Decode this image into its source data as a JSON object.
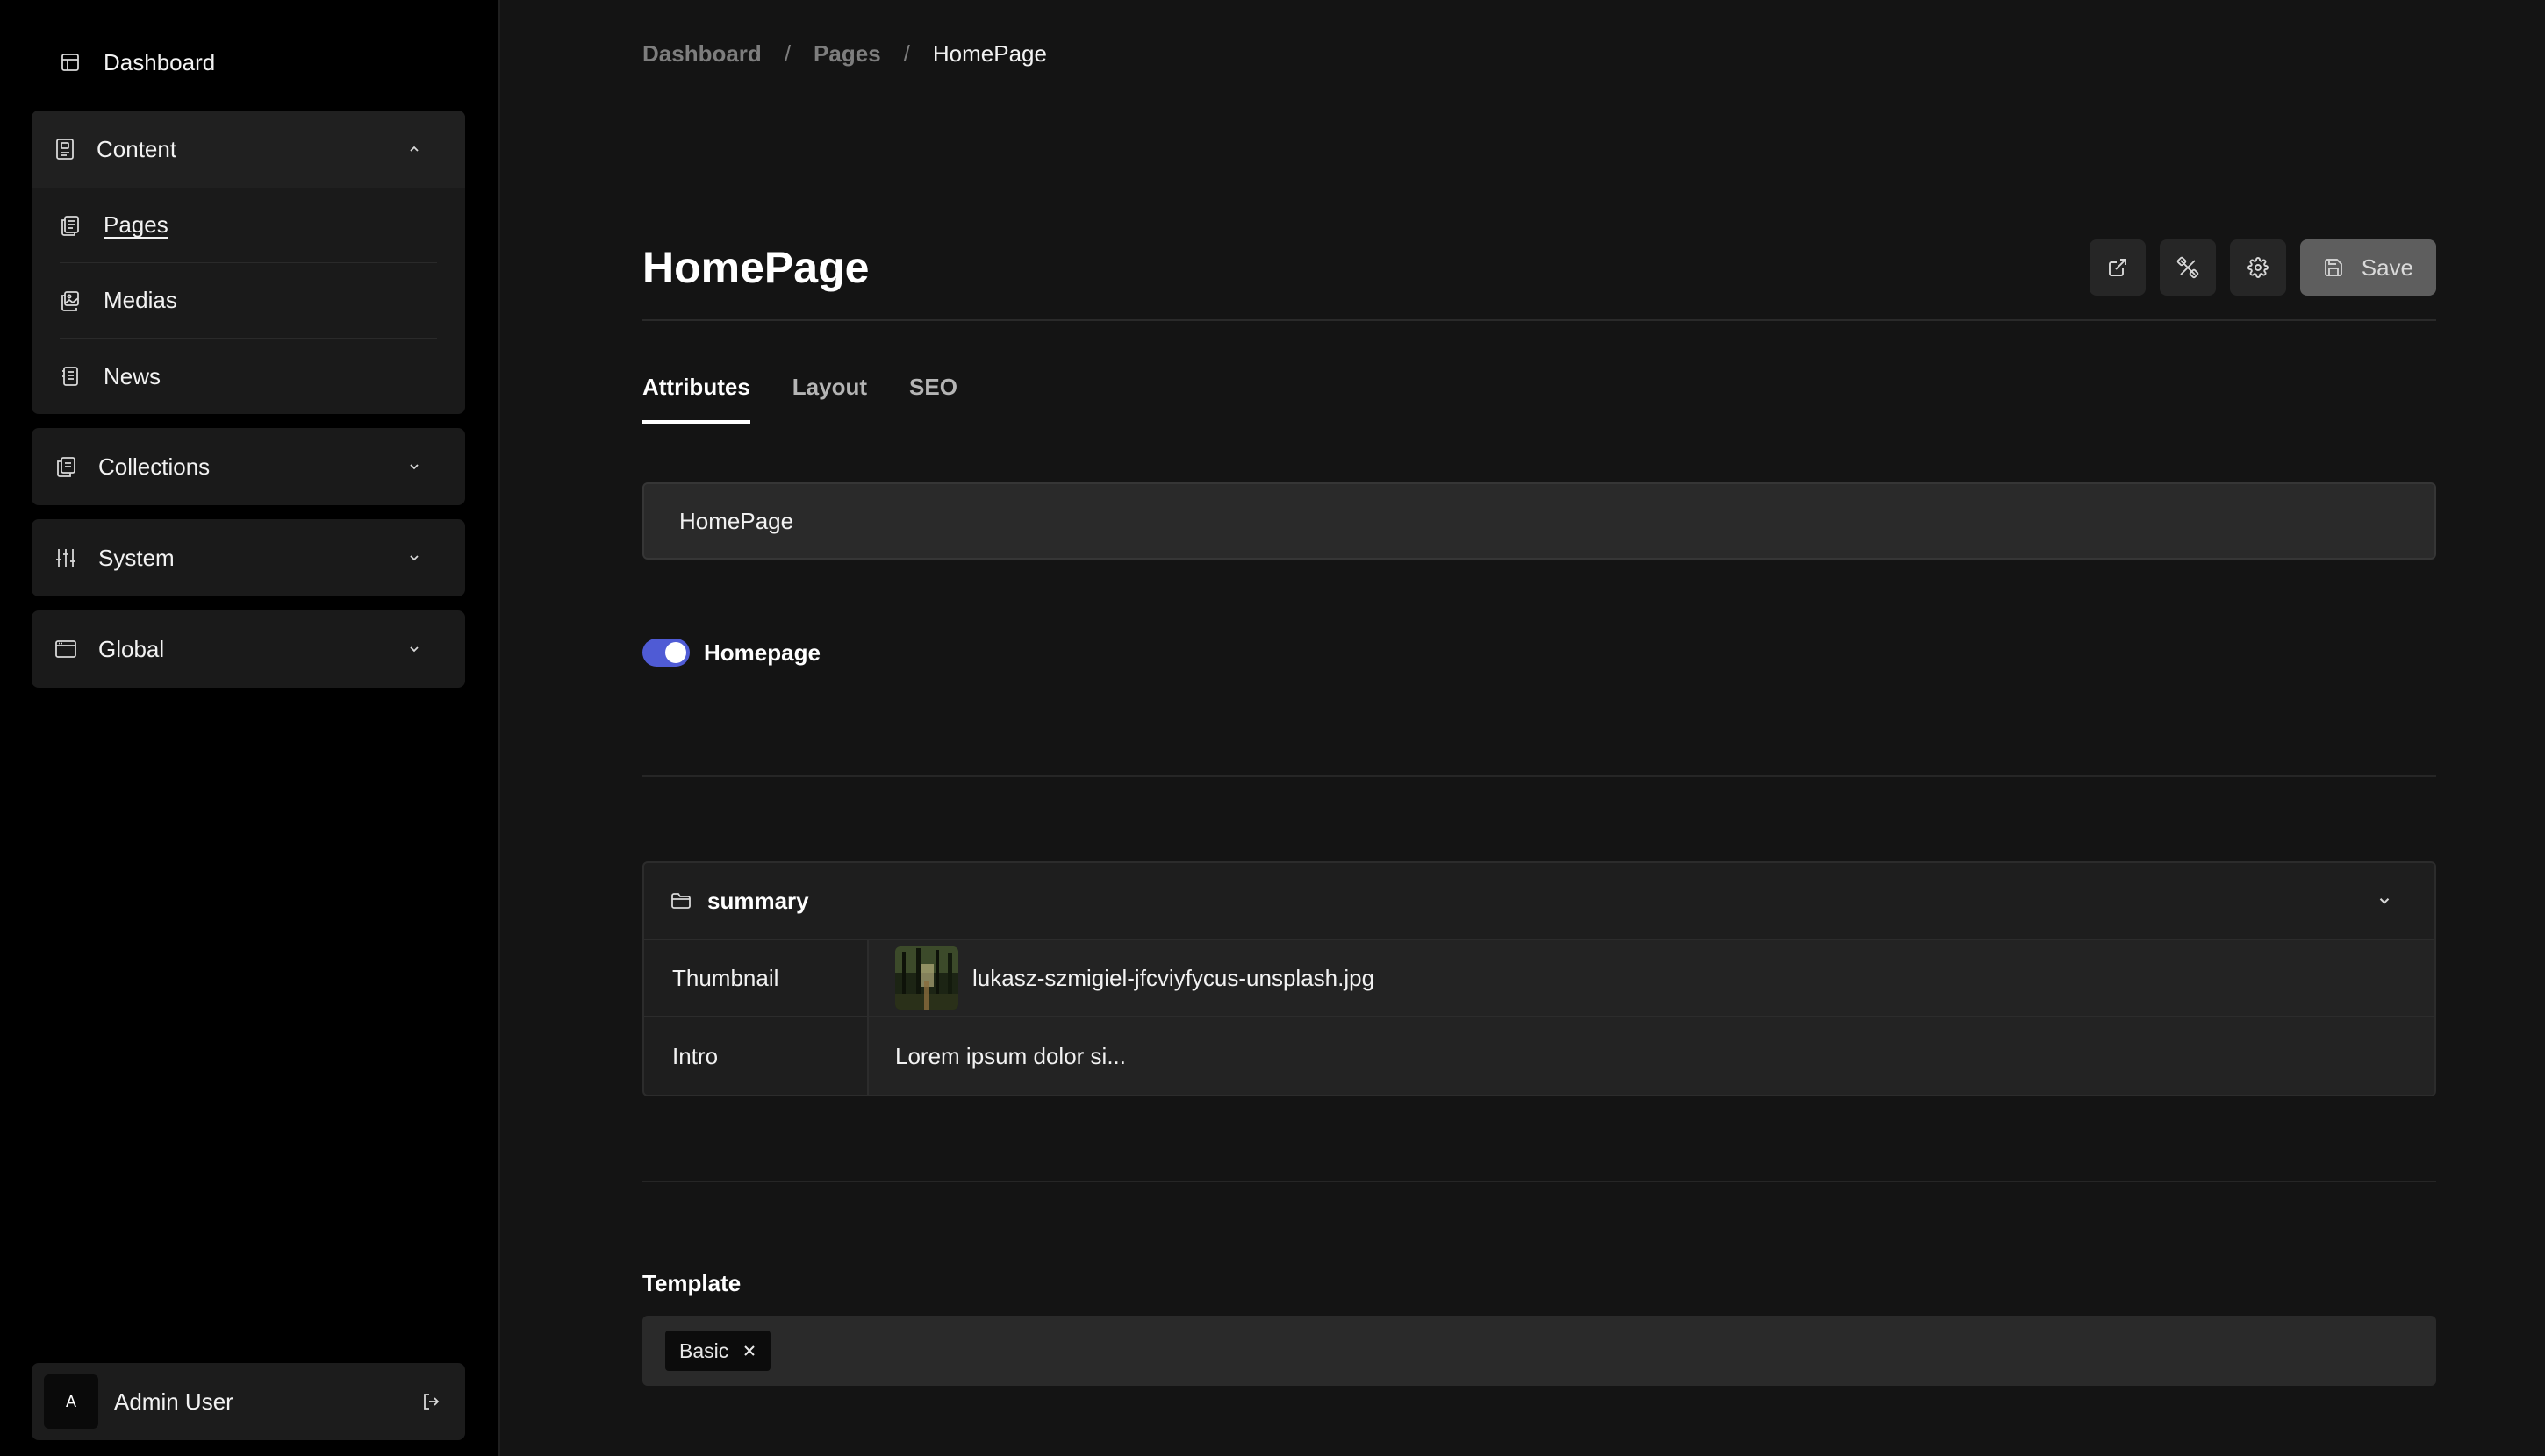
{
  "sidebar": {
    "dashboard": {
      "label": "Dashboard",
      "icon": "layout-dashboard-icon"
    },
    "groups": [
      {
        "label": "Content",
        "icon": "content-icon",
        "expanded": true,
        "items": [
          {
            "label": "Pages",
            "icon": "pages-icon",
            "active": true
          },
          {
            "label": "Medias",
            "icon": "image-icon",
            "active": false
          },
          {
            "label": "News",
            "icon": "news-icon",
            "active": false
          }
        ]
      },
      {
        "label": "Collections",
        "icon": "collections-icon",
        "expanded": false
      },
      {
        "label": "System",
        "icon": "sliders-icon",
        "expanded": false
      },
      {
        "label": "Global",
        "icon": "window-icon",
        "expanded": false
      }
    ],
    "user": {
      "initial": "A",
      "name": "Admin User"
    }
  },
  "breadcrumb": {
    "items": [
      "Dashboard",
      "Pages"
    ],
    "separator": "/",
    "current": "HomePage"
  },
  "page": {
    "title": "HomePage",
    "save_label": "Save"
  },
  "tabs": [
    {
      "label": "Attributes",
      "active": true
    },
    {
      "label": "Layout",
      "active": false
    },
    {
      "label": "SEO",
      "active": false
    }
  ],
  "form": {
    "title_value": "HomePage",
    "homepage_toggle": {
      "label": "Homepage",
      "on": true
    },
    "summary": {
      "title": "summary",
      "rows": [
        {
          "key": "Thumbnail",
          "value": "lukasz-szmigiel-jfcviyfycus-unsplash.jpg"
        },
        {
          "key": "Intro",
          "value": "Lorem ipsum dolor si..."
        }
      ]
    },
    "template": {
      "label": "Template",
      "chip": "Basic"
    }
  },
  "colors": {
    "accent": "#4f5bd5",
    "background": "#141414",
    "sidebar": "#000000"
  }
}
